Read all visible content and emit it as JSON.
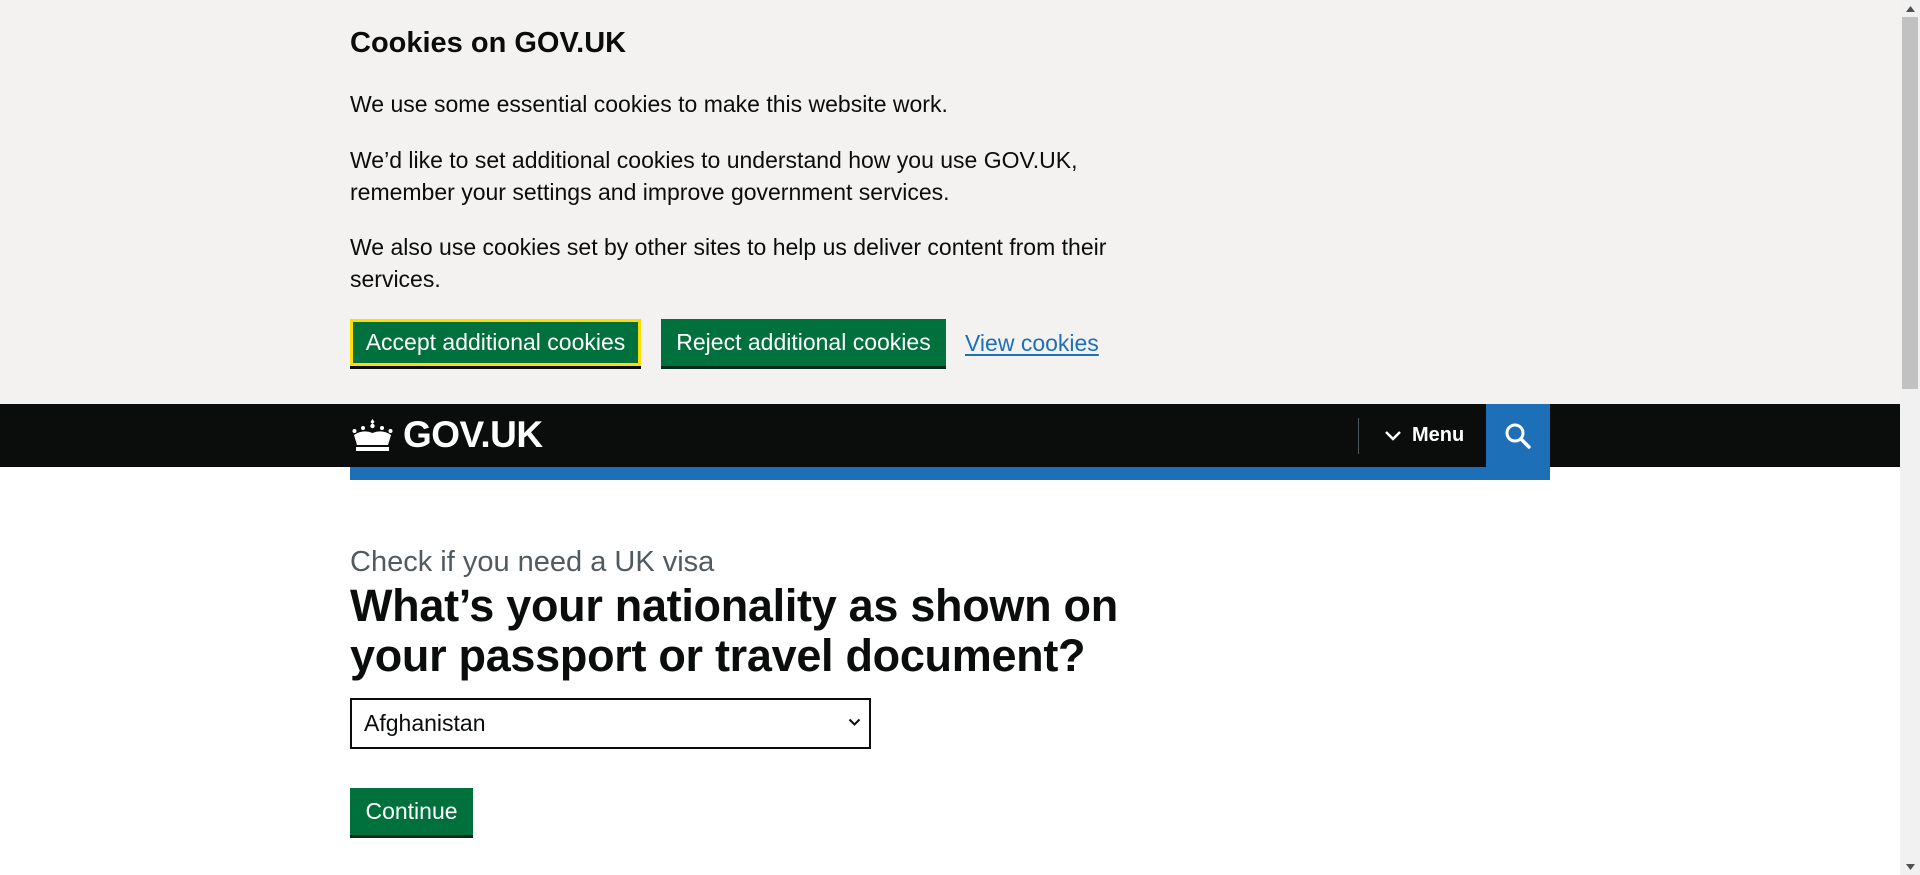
{
  "cookie_banner": {
    "title": "Cookies on GOV.UK",
    "paragraph_1": "We use some essential cookies to make this website work.",
    "paragraph_2": "We’d like to set additional cookies to understand how you use GOV.UK, remember your settings and improve government services.",
    "paragraph_3": "We also use cookies set by other sites to help us deliver content from their services.",
    "accept_label": "Accept additional cookies",
    "reject_label": "Reject additional cookies",
    "view_label": "View cookies"
  },
  "header": {
    "logo_text": "GOV.UK",
    "logo_icon": "crown-icon",
    "menu_label": "Menu",
    "menu_icon": "chevron-down-icon",
    "search_icon": "search-icon",
    "search_color": "#1d70b8"
  },
  "main": {
    "caption": "Check if you need a UK visa",
    "heading": "What’s your nationality as shown on your passport or travel document?",
    "nationality_select": {
      "selected": "Afghanistan"
    },
    "continue_label": "Continue"
  },
  "colors": {
    "button_green": "#00703c",
    "link_blue": "#1d70b8",
    "focus_yellow": "#ffdd00",
    "banner_bg": "#f3f2f1",
    "header_bg": "#0b0c0c"
  }
}
